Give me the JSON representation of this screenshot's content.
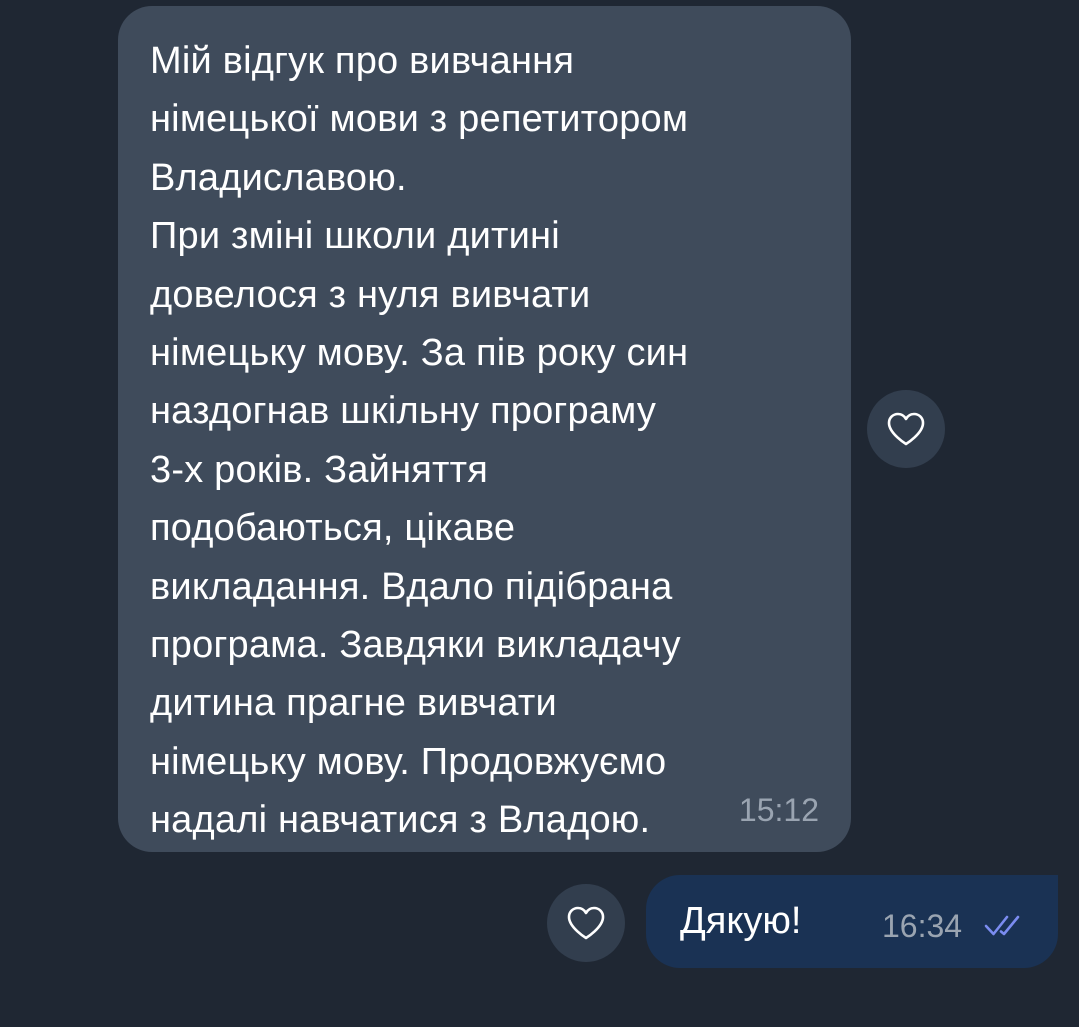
{
  "incoming_message": {
    "text": "Мій відгук про вивчання\nнімецької мови з репетитором\nВладиславою.\nПри зміні школи дитині\nдовелося з нуля вивчати\nнімецьку мову. За пів року син\nназдогнав шкільну програму\n3-х років. Зайняття\nподобаються, цікаве\nвикладання. Вдало підібрана\nпрограма. Завдяки викладачу\nдитина прагне вивчати\nнімецьку мову. Продовжуємо\nнадалі навчатися з Владою.",
    "time": "15:12",
    "reaction_icon": "heart-outline-icon"
  },
  "outgoing_message": {
    "text": "Дякую!",
    "time": "16:34",
    "status_icon": "double-check-icon",
    "reaction_icon": "heart-outline-icon"
  },
  "colors": {
    "background": "#1f2733",
    "incoming_bubble": "#3f4b5b",
    "outgoing_bubble": "#1a3254",
    "reaction_button": "#323e4e",
    "time_text": "#9aa4b1",
    "read_check": "#7b8cf0"
  }
}
